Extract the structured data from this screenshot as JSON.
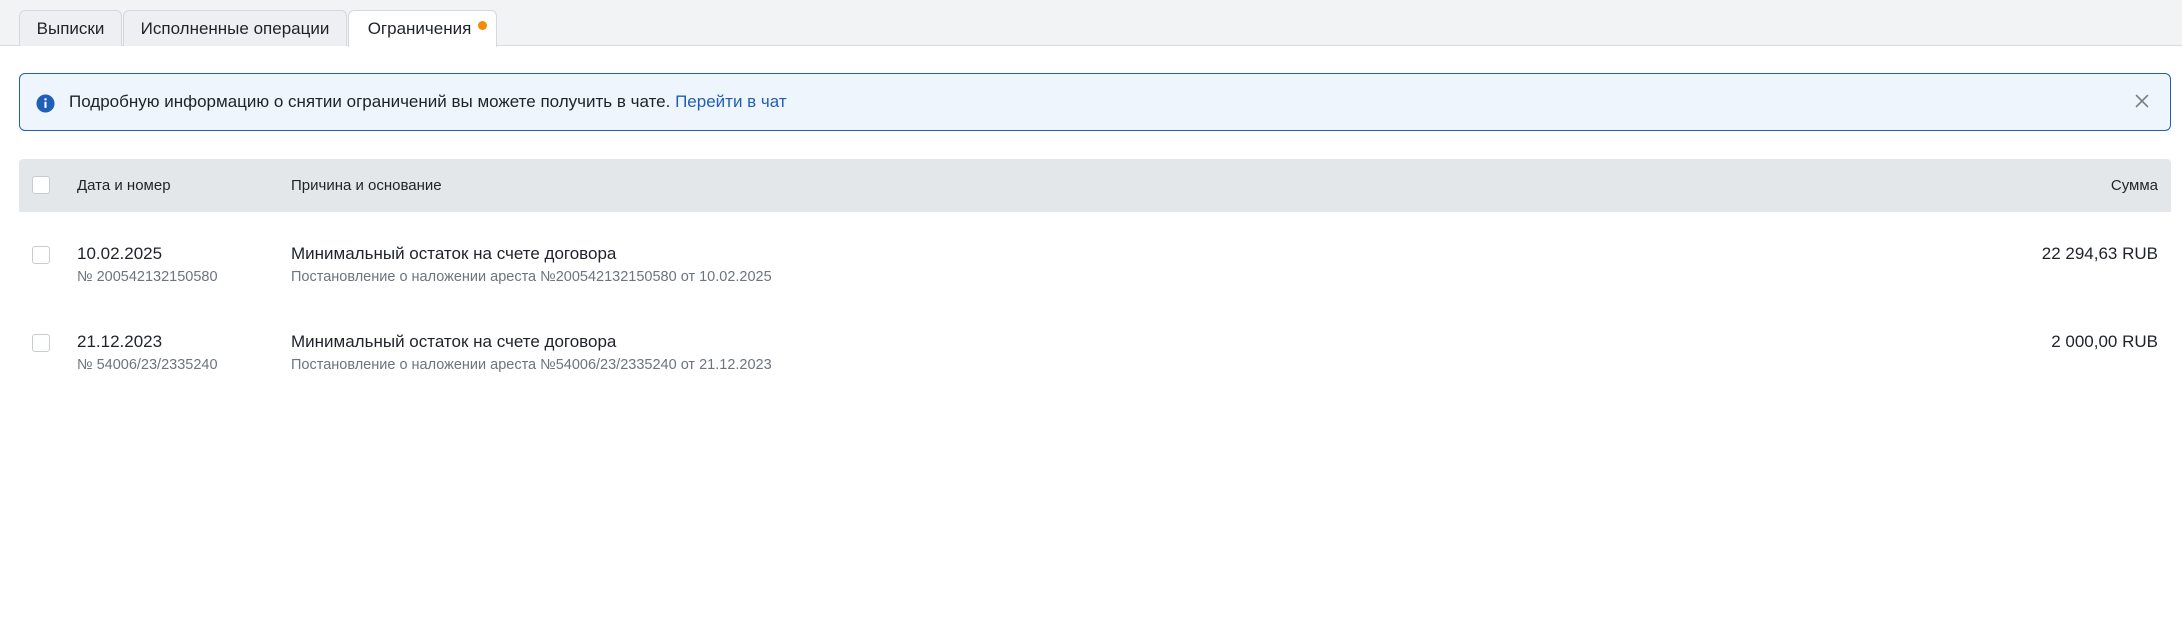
{
  "tabs": [
    {
      "label": "Выписки"
    },
    {
      "label": "Исполненные операции"
    },
    {
      "label": "Ограничения",
      "has_notification": true
    }
  ],
  "banner": {
    "text": "Подробную информацию о снятии ограничений вы можете получить в чате.",
    "link": "Перейти в чат"
  },
  "table": {
    "headers": {
      "date": "Дата и номер",
      "reason": "Причина и основание",
      "amount": "Сумма"
    },
    "rows": [
      {
        "date": "10.02.2025",
        "number": "№ 200542132150580",
        "reason": "Минимальный остаток на счете договора",
        "basis": "Постановление о наложении ареста №200542132150580 от 10.02.2025",
        "amount": "22 294,63 RUB"
      },
      {
        "date": "21.12.2023",
        "number": "№ 54006/23/2335240",
        "reason": "Минимальный остаток на счете договора",
        "basis": "Постановление о наложении ареста №54006/23/2335240 от 21.12.2023",
        "amount": "2 000,00 RUB"
      }
    ]
  },
  "colors": {
    "accent": "#1f5fb8",
    "notification_dot": "#f58a07",
    "banner_bg": "#eef5fd",
    "header_bg": "#e4e7ea"
  }
}
